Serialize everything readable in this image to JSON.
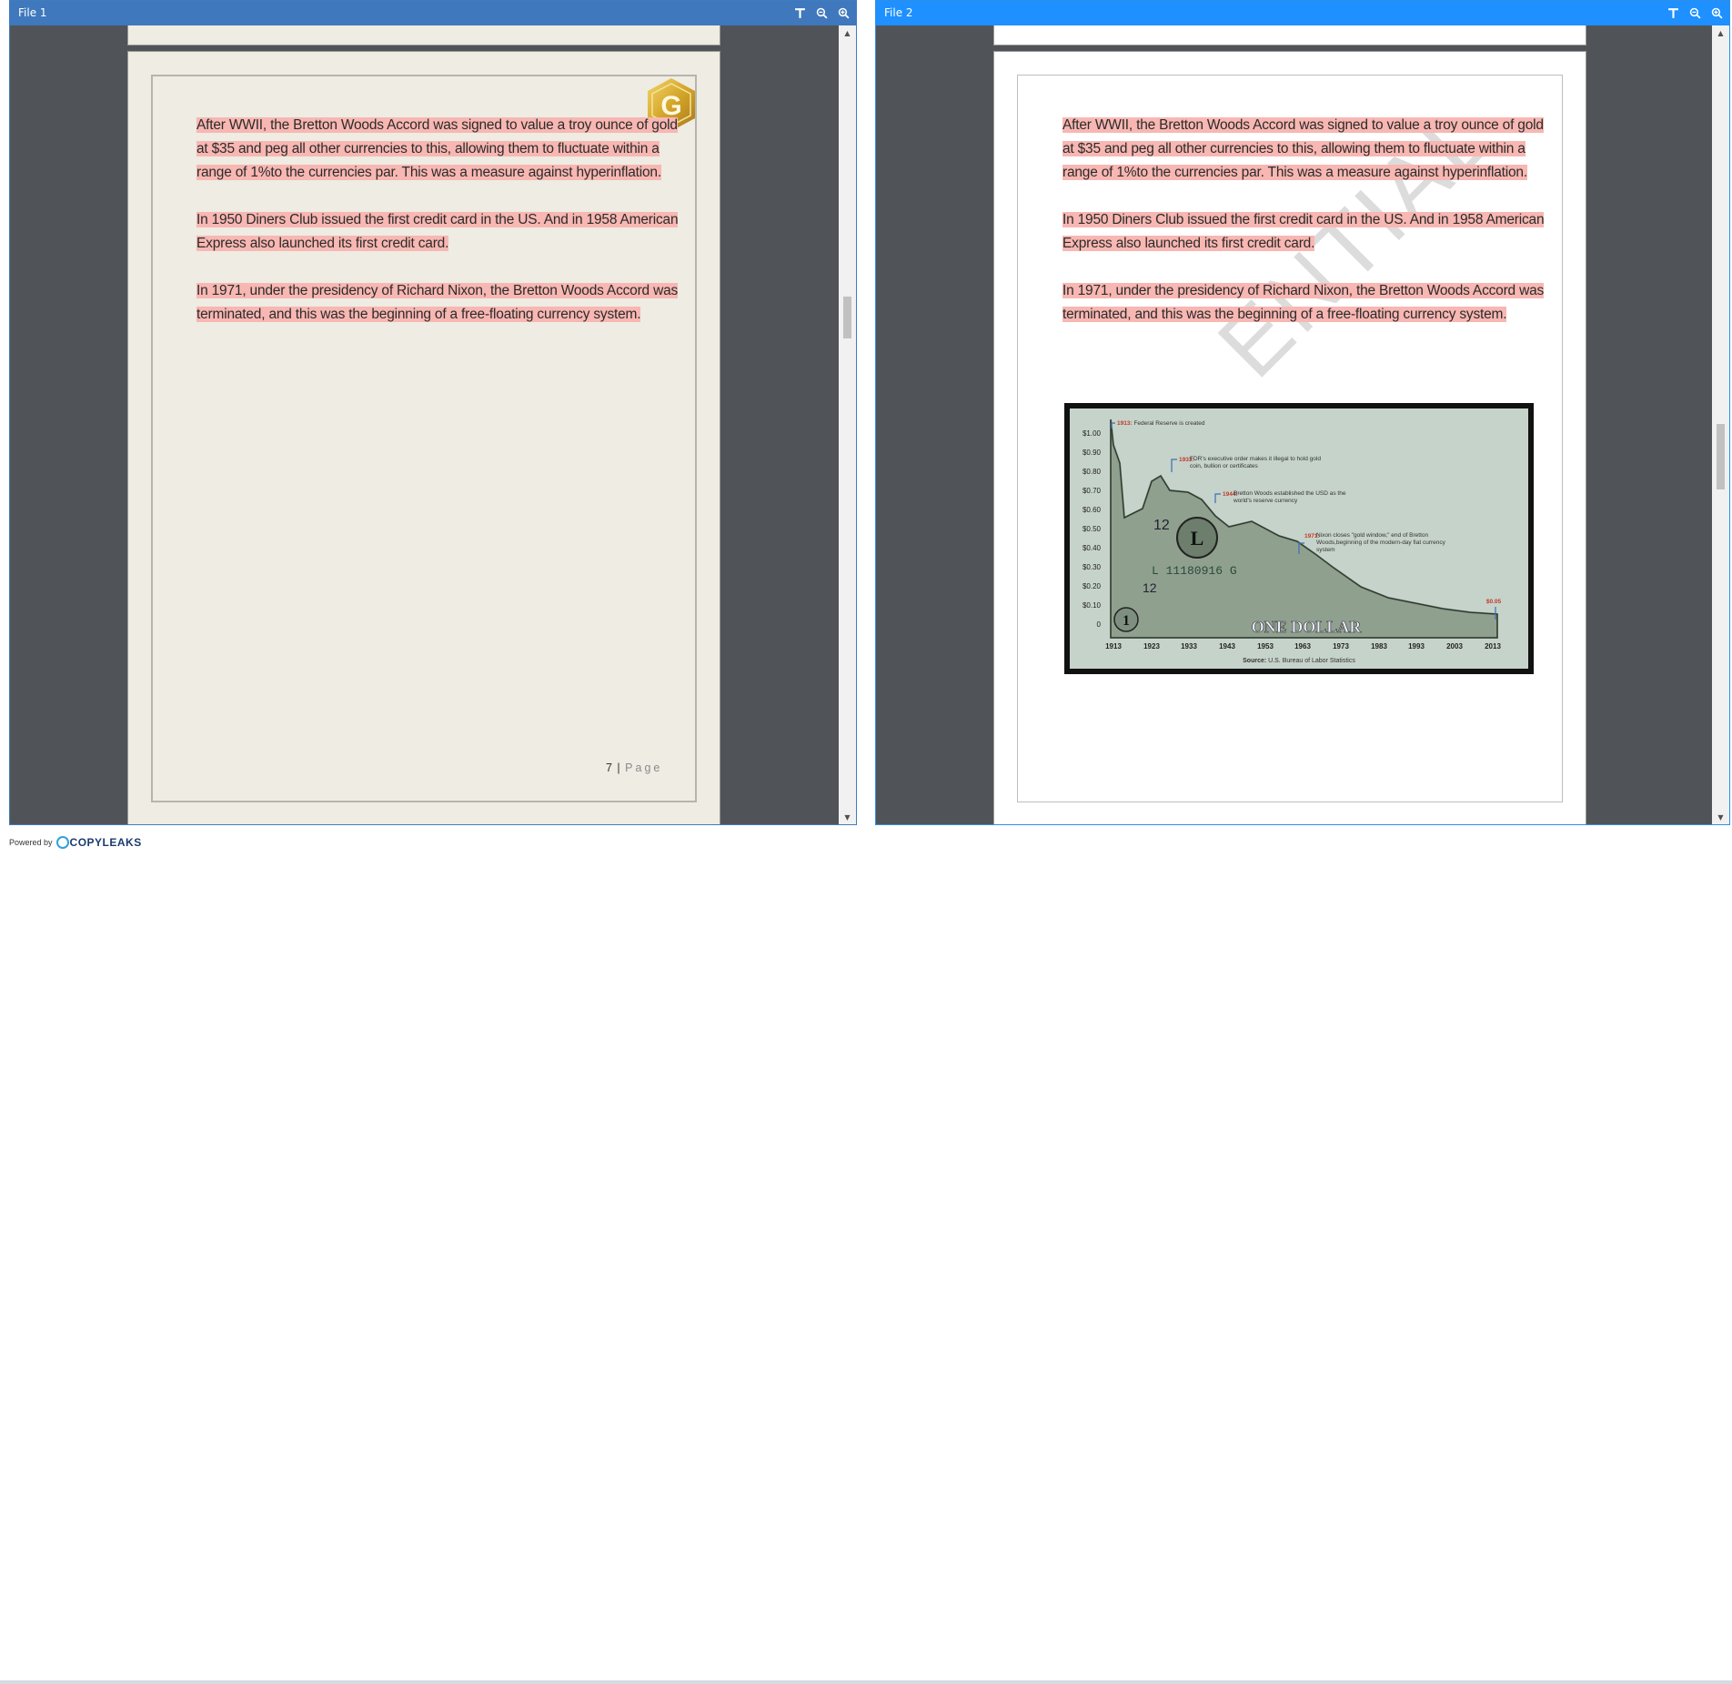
{
  "left_pane": {
    "title": "File 1",
    "page_number": "7",
    "page_separator": " | ",
    "page_word": "Page",
    "paragraphs": [
      "After WWII, the Bretton Woods Accord was signed to value a troy ounce of gold at $35 and peg all other currencies to this, allowing them to fluctuate within a range of 1%to the currencies par. This was a measure against hyperinflation.",
      "In 1950 Diners Club issued the first credit card in the US. And in 1958 American Express also launched its first credit card.",
      "In 1971, under the presidency of Richard Nixon, the Bretton Woods Accord was terminated, and this was the beginning of a free-floating currency system."
    ],
    "logo_letter": "G"
  },
  "right_pane": {
    "title": "File 2",
    "watermark": "ENTIAL",
    "paragraphs": [
      "After WWII, the Bretton Woods Accord was signed to value a troy ounce of gold at $35 and peg all other currencies to this, allowing them to fluctuate within a range of 1%to the currencies par. This was a measure against hyperinflation.",
      "In 1950 Diners Club issued the first credit card in the US. And in 1958 American Express also launched its first credit card.",
      "In 1971, under the presidency of Richard Nixon, the Bretton Woods Accord was terminated, and this was the beginning of a free-floating currency system."
    ],
    "embedded_chart": {
      "y_ticks": [
        "$1.00",
        "$0.90",
        "$0.80",
        "$0.70",
        "$0.60",
        "$0.50",
        "$0.40",
        "$0.30",
        "$0.20",
        "$0.10",
        "0"
      ],
      "x_ticks": [
        "1913",
        "1923",
        "1933",
        "1943",
        "1953",
        "1963",
        "1973",
        "1983",
        "1993",
        "2003",
        "2013"
      ],
      "annotations": [
        {
          "year": "1913:",
          "text": "Federal Reserve is created"
        },
        {
          "year": "1933:",
          "text": "FDR's executive order makes it illegal to hold gold coin, bullion or certificates"
        },
        {
          "year": "1944:",
          "text": "Bretton Woods established the USD as the world's reserve currency"
        },
        {
          "year": "1971:",
          "text": "Nixon closes \"gold window,\" end of Bretton Woods,beginning of the modern-day fiat currency system"
        }
      ],
      "end_value": "$0.05",
      "source_label": "Source:",
      "source_text": "U.S. Bureau of Labor Statistics",
      "bill_serial": "L 11180916 G",
      "bill_text": "ONE DOLLAR",
      "bill_number": "12",
      "bill_letter": "L",
      "bill_one": "1"
    }
  },
  "toolbar_icons": [
    "text-tool-icon",
    "zoom-out-icon",
    "zoom-in-icon"
  ],
  "footer": {
    "powered_by": "Powered by",
    "brand": "COPYLEAKS"
  },
  "colors": {
    "highlight": "#f8b7b2",
    "left_titlebar": "#3f78bd",
    "right_titlebar": "#1e90ff",
    "viewer_background": "#505459"
  }
}
